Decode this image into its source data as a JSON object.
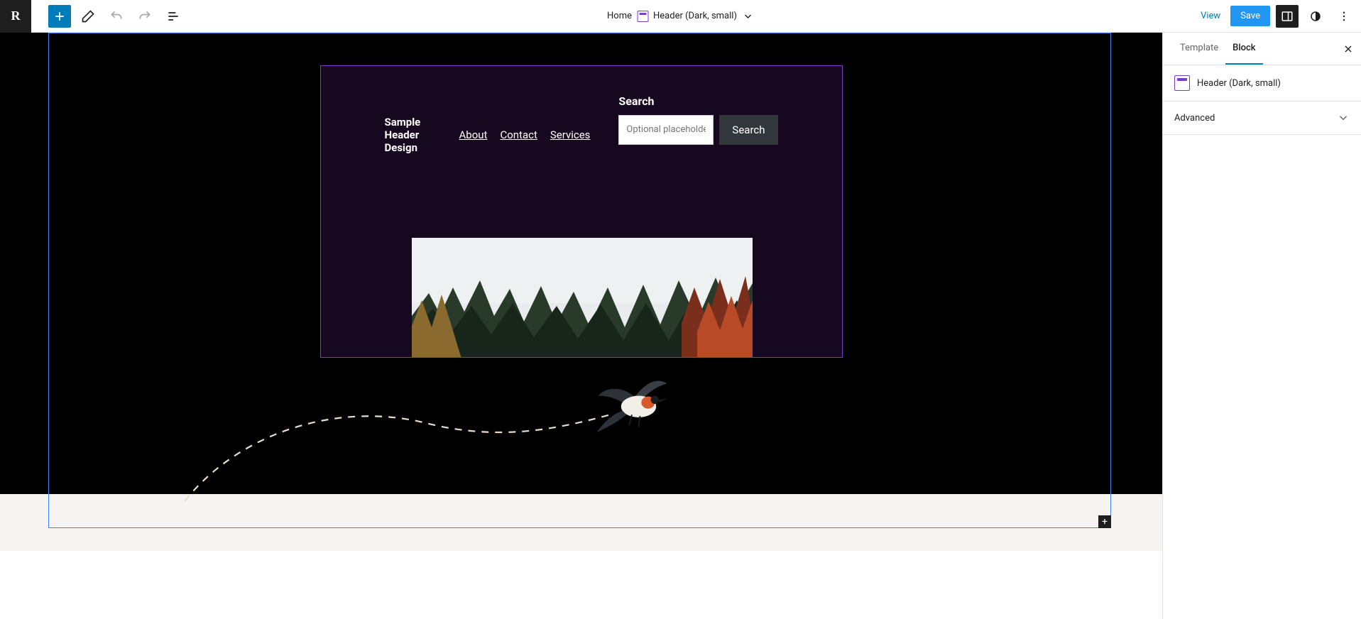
{
  "topbar": {
    "logo_letter": "R",
    "center": {
      "breadcrumb": "Home",
      "template_part": "Header (Dark, small)"
    },
    "view_label": "View",
    "save_label": "Save"
  },
  "canvas": {
    "site_title": "Sample Header Design",
    "nav": [
      "About",
      "Contact",
      "Services"
    ],
    "search": {
      "label": "Search",
      "placeholder": "Optional placeholder…",
      "button": "Search"
    }
  },
  "sidebar": {
    "tabs": {
      "template": "Template",
      "block": "Block"
    },
    "block_name": "Header (Dark, small)",
    "advanced_label": "Advanced"
  }
}
